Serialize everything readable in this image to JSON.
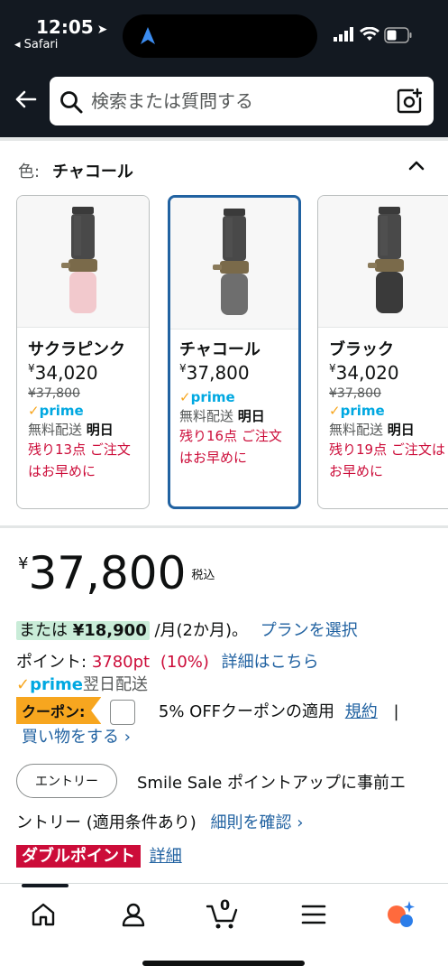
{
  "status": {
    "time": "12:05",
    "back_app": "◂ Safari"
  },
  "search": {
    "placeholder": "検索または質問する"
  },
  "color": {
    "label": "色:",
    "value": "チャコール"
  },
  "variants": [
    {
      "name": "サクラピンク",
      "currency": "¥",
      "price": "34,020",
      "list_price": "¥37,800",
      "prime": "prime",
      "ship_label": "無料配送",
      "ship_day": "明日",
      "stock": "残り13点 ご注文はお早めに",
      "body_color": "#f2c9cd"
    },
    {
      "name": "チャコール",
      "currency": "¥",
      "price": "37,800",
      "prime": "prime",
      "ship_label": "無料配送",
      "ship_day": "明日",
      "stock": "残り16点 ご注文はお早めに",
      "body_color": "#6e6e6e"
    },
    {
      "name": "ブラック",
      "currency": "¥",
      "price": "34,020",
      "list_price": "¥37,800",
      "prime": "prime",
      "ship_label": "無料配送",
      "ship_day": "明日",
      "stock": "残り19点 ご注文はお早めに",
      "body_color": "#3a3a3a"
    }
  ],
  "price": {
    "currency": "¥",
    "amount": "37,800",
    "tax_note": "税込"
  },
  "installment": {
    "prefix": "または",
    "amount": "¥18,900",
    "suffix": "/月(2か月)。",
    "link": "プランを選択"
  },
  "points": {
    "label": "ポイント:",
    "value": "3780pt",
    "percent": "(10%)",
    "link": "詳細はこちら"
  },
  "prime_delivery": {
    "prime": "prime",
    "text": "翌日配送"
  },
  "coupon": {
    "badge": "クーポン:",
    "text": "5% OFFクーポンの適用",
    "terms": "規約",
    "separator": "|",
    "shop": "買い物をする ›"
  },
  "entry": {
    "button": "エントリー",
    "text_1": "Smile Sale ポイントアップに事前エ",
    "text_2": "ントリー (適用条件あり)",
    "link": "細則を確認 ›"
  },
  "double_point": {
    "badge": "ダブルポイント",
    "link": "詳細"
  },
  "nav": {
    "cart_count": "0"
  },
  "colors": {
    "header_bg": "#131921",
    "link": "#2162a1",
    "deal_red": "#cc0c39",
    "prime_blue": "#00a8e1",
    "coupon_orange": "#f7a61f",
    "selected_border": "#2162a1"
  }
}
